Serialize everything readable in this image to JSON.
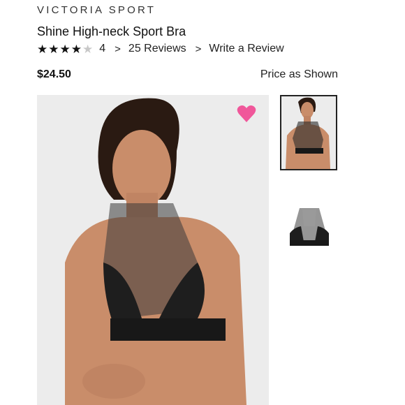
{
  "product": {
    "brand": "VICTORIA SPORT",
    "title": "Shine High-neck Sport Bra",
    "rating": {
      "value": "4",
      "stars_filled": 4,
      "stars_total": 5,
      "reviews_label": "25 Reviews",
      "write_review_label": "Write a Review"
    },
    "price": "$24.50",
    "price_note": "Price as Shown"
  },
  "icons": {
    "favorite": "heart-icon",
    "star": "star-icon",
    "chevron": "chevron-right-icon"
  },
  "colors": {
    "heart": "#f0579a",
    "text": "#1a1a1a",
    "image_background": "#ececec"
  },
  "images": {
    "main": "model wearing black high-neck sport bra",
    "thumbnails": [
      "model wearing sport bra",
      "sport bra product flat view"
    ]
  }
}
